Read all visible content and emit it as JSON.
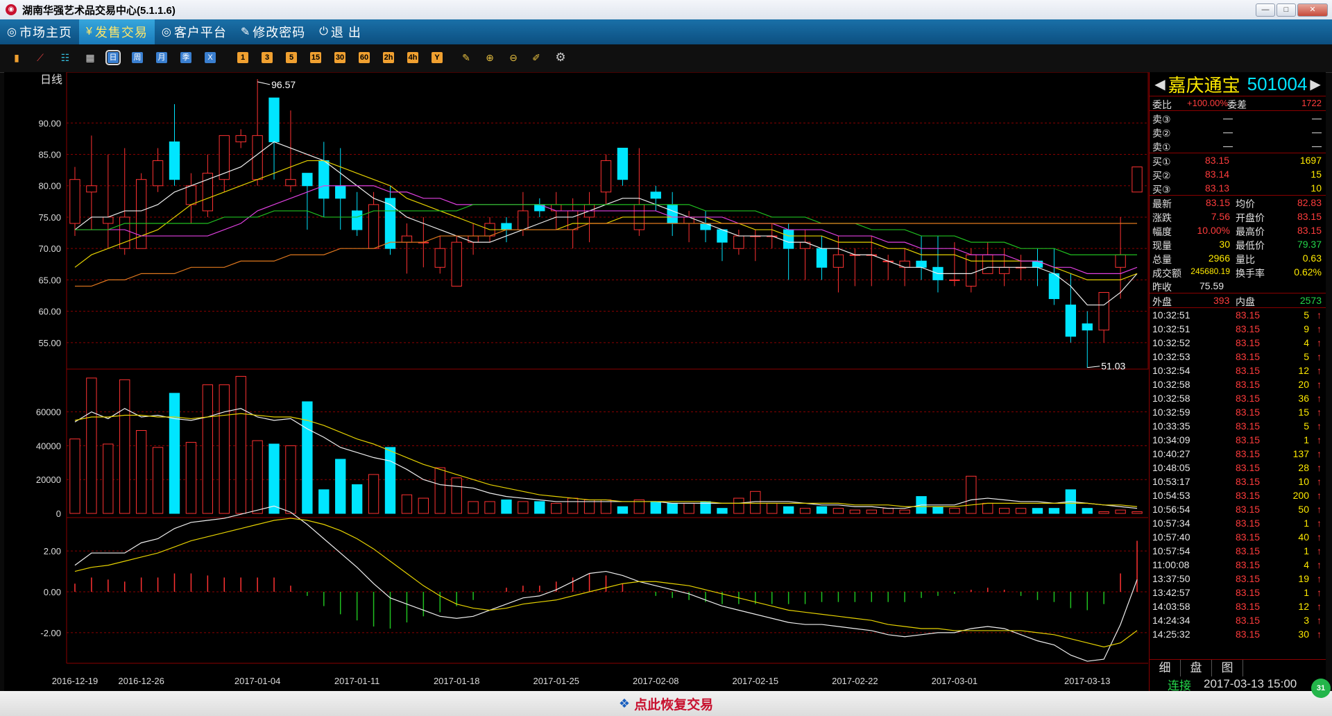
{
  "window": {
    "title": "湖南华强艺术品交易中心(5.1.1.6)",
    "min_label": "—",
    "max_label": "□",
    "close_label": "✕"
  },
  "menu": {
    "items": [
      {
        "icon": "◎",
        "label": "市场主页",
        "active": false
      },
      {
        "icon": "¥",
        "label": "发售交易",
        "active": true
      },
      {
        "icon": "◎",
        "label": "客户平台",
        "active": false
      },
      {
        "icon": "✎",
        "label": "修改密码",
        "active": false
      },
      {
        "icon": "⏻",
        "label": "退  出",
        "active": false
      }
    ]
  },
  "toolbar": {
    "chart_icons": [
      "bar-chart-icon",
      "line-chart-icon",
      "candlestick-icon",
      "calendar-icon"
    ],
    "period_buttons": [
      "日",
      "周",
      "月",
      "季",
      "X"
    ],
    "minute_buttons": [
      "1",
      "3",
      "5",
      "15",
      "30",
      "60",
      "2h",
      "4h",
      "Y"
    ],
    "settings_icon": "gear-icon"
  },
  "quote": {
    "name": "嘉庆通宝",
    "code": "501004",
    "weibi_label": "委比",
    "weibi": "+100.00%",
    "weicha_label": "委差",
    "weicha": "1722",
    "sell": [
      {
        "label": "卖③",
        "price": "—",
        "vol": "—"
      },
      {
        "label": "卖②",
        "price": "—",
        "vol": "—"
      },
      {
        "label": "卖①",
        "price": "—",
        "vol": "—"
      }
    ],
    "buy": [
      {
        "label": "买①",
        "price": "83.15",
        "vol": "1697"
      },
      {
        "label": "买②",
        "price": "83.14",
        "vol": "15"
      },
      {
        "label": "买③",
        "price": "83.13",
        "vol": "10"
      }
    ],
    "stats": [
      {
        "l1": "最新",
        "v1": "83.15",
        "l2": "均价",
        "v2": "82.83"
      },
      {
        "l1": "涨跌",
        "v1": "7.56",
        "l2": "开盘价",
        "v2": "83.15"
      },
      {
        "l1": "幅度",
        "v1": "10.00%",
        "l2": "最高价",
        "v2": "83.15"
      },
      {
        "l1": "现量",
        "v1": "30",
        "l2": "最低价",
        "v2": "79.37"
      },
      {
        "l1": "总量",
        "v1": "2966",
        "l2": "量比",
        "v2": "0.63"
      },
      {
        "l1": "成交额",
        "v1": "245680.19",
        "l2": "换手率",
        "v2": "0.62%"
      }
    ],
    "zuoshou_label": "昨收",
    "zuoshou": "75.59",
    "waipan_label": "外盘",
    "waipan": "393",
    "neipan_label": "内盘",
    "neipan": "2573",
    "ticks": [
      {
        "t": "10:32:51",
        "p": "83.15",
        "v": "5"
      },
      {
        "t": "10:32:51",
        "p": "83.15",
        "v": "9"
      },
      {
        "t": "10:32:52",
        "p": "83.15",
        "v": "4"
      },
      {
        "t": "10:32:53",
        "p": "83.15",
        "v": "5"
      },
      {
        "t": "10:32:54",
        "p": "83.15",
        "v": "12"
      },
      {
        "t": "10:32:58",
        "p": "83.15",
        "v": "20"
      },
      {
        "t": "10:32:58",
        "p": "83.15",
        "v": "36"
      },
      {
        "t": "10:32:59",
        "p": "83.15",
        "v": "15"
      },
      {
        "t": "10:33:35",
        "p": "83.15",
        "v": "5"
      },
      {
        "t": "10:34:09",
        "p": "83.15",
        "v": "1"
      },
      {
        "t": "10:40:27",
        "p": "83.15",
        "v": "137"
      },
      {
        "t": "10:48:05",
        "p": "83.15",
        "v": "28"
      },
      {
        "t": "10:53:17",
        "p": "83.15",
        "v": "10"
      },
      {
        "t": "10:54:53",
        "p": "83.15",
        "v": "200"
      },
      {
        "t": "10:56:54",
        "p": "83.15",
        "v": "50"
      },
      {
        "t": "10:57:34",
        "p": "83.15",
        "v": "1"
      },
      {
        "t": "10:57:40",
        "p": "83.15",
        "v": "40"
      },
      {
        "t": "10:57:54",
        "p": "83.15",
        "v": "1"
      },
      {
        "t": "11:00:08",
        "p": "83.15",
        "v": "4"
      },
      {
        "t": "13:37:50",
        "p": "83.15",
        "v": "19"
      },
      {
        "t": "13:42:57",
        "p": "83.15",
        "v": "1"
      },
      {
        "t": "14:03:58",
        "p": "83.15",
        "v": "12"
      },
      {
        "t": "14:24:34",
        "p": "83.15",
        "v": "3"
      },
      {
        "t": "14:25:32",
        "p": "83.15",
        "v": "30"
      }
    ],
    "tabs": [
      "细",
      "盘",
      "图"
    ],
    "status": "连接",
    "datetime": "2017-03-13 15:00"
  },
  "bottom": {
    "restore_label": "点此恢复交易",
    "badge": "31"
  },
  "chart_data": {
    "type": "candlestick",
    "period_label": "日线",
    "price_ticks": [
      90,
      85,
      80,
      75,
      70,
      65,
      60,
      55
    ],
    "price_tick_labels": [
      "90.00",
      "85.00",
      "80.00",
      "75.00",
      "70.00",
      "65.00",
      "60.00",
      "55.00"
    ],
    "price_range": [
      51,
      97
    ],
    "high_label": "96.57",
    "low_label": "51.03",
    "vol_ticks": [
      60000,
      40000,
      20000,
      0
    ],
    "vol_tick_labels": [
      "60000",
      "40000",
      "20000",
      "0"
    ],
    "vol_range": [
      0,
      82000
    ],
    "macd_ticks": [
      2,
      0,
      -2
    ],
    "macd_tick_labels": [
      "2.00",
      "0.00",
      "-2.00"
    ],
    "macd_range": [
      -3.5,
      3.5
    ],
    "date_labels": [
      {
        "i": 0,
        "t": "2016-12-19"
      },
      {
        "i": 4,
        "t": "2016-12-26"
      },
      {
        "i": 11,
        "t": "2017-01-04"
      },
      {
        "i": 17,
        "t": "2017-01-11"
      },
      {
        "i": 23,
        "t": "2017-01-18"
      },
      {
        "i": 29,
        "t": "2017-01-25"
      },
      {
        "i": 35,
        "t": "2017-02-08"
      },
      {
        "i": 41,
        "t": "2017-02-15"
      },
      {
        "i": 47,
        "t": "2017-02-22"
      },
      {
        "i": 53,
        "t": "2017-03-01"
      },
      {
        "i": 61,
        "t": "2017-03-13"
      }
    ],
    "candles": [
      [
        74,
        81,
        72,
        83
      ],
      [
        79,
        80,
        73,
        88
      ],
      [
        74,
        75,
        70,
        85
      ],
      [
        70,
        75,
        69,
        86
      ],
      [
        70,
        81,
        70,
        82
      ],
      [
        80,
        84,
        79,
        86
      ],
      [
        87,
        81,
        80,
        93
      ],
      [
        77,
        80,
        74,
        82
      ],
      [
        76,
        82,
        75,
        85
      ],
      [
        81,
        88,
        79,
        88
      ],
      [
        87,
        88,
        86,
        89
      ],
      [
        81,
        88,
        80,
        97
      ],
      [
        94,
        87,
        81,
        94
      ],
      [
        80,
        81,
        79,
        92
      ],
      [
        82,
        80,
        73,
        82
      ],
      [
        84,
        78,
        75,
        87
      ],
      [
        80,
        78,
        73,
        86
      ],
      [
        76,
        73,
        72,
        79
      ],
      [
        70,
        77,
        70,
        79
      ],
      [
        78,
        70,
        69,
        80
      ],
      [
        71,
        72,
        66,
        74
      ],
      [
        71,
        71,
        67,
        75
      ],
      [
        67,
        70,
        66,
        72
      ],
      [
        64,
        71,
        64,
        72
      ],
      [
        71,
        72,
        69,
        74
      ],
      [
        72,
        74,
        71,
        75
      ],
      [
        74,
        73,
        71,
        75
      ],
      [
        73,
        76,
        72,
        79
      ],
      [
        77,
        76,
        75,
        78
      ],
      [
        76,
        77,
        73,
        79
      ],
      [
        73,
        76,
        70,
        78
      ],
      [
        75,
        77,
        71,
        79
      ],
      [
        79,
        84,
        77,
        85
      ],
      [
        86,
        81,
        80,
        86
      ],
      [
        73,
        77,
        72,
        86
      ],
      [
        79,
        78,
        76,
        80
      ],
      [
        77,
        74,
        72,
        79
      ],
      [
        74,
        75,
        71,
        76
      ],
      [
        74,
        73,
        71,
        76
      ],
      [
        73,
        71,
        68,
        73
      ],
      [
        70,
        72,
        69,
        73
      ],
      [
        72,
        72,
        68,
        73
      ],
      [
        72,
        72,
        70,
        74
      ],
      [
        73,
        70,
        65,
        74
      ],
      [
        70,
        71,
        65,
        73
      ],
      [
        70,
        67,
        65,
        72
      ],
      [
        67,
        69,
        63,
        72
      ],
      [
        69,
        69,
        64,
        70
      ],
      [
        69,
        69,
        64,
        72
      ],
      [
        68,
        68,
        65,
        69
      ],
      [
        67,
        68,
        64,
        70
      ],
      [
        68,
        67,
        65,
        72
      ],
      [
        67,
        65,
        63,
        72
      ],
      [
        65,
        65,
        64,
        71
      ],
      [
        64,
        69,
        63,
        70
      ],
      [
        66,
        69,
        66,
        71
      ],
      [
        66,
        67,
        64,
        70
      ],
      [
        67,
        67,
        65,
        69
      ],
      [
        68,
        67,
        64,
        70
      ],
      [
        66,
        62,
        61,
        70
      ],
      [
        61,
        56,
        55,
        66
      ],
      [
        58,
        57,
        51,
        60
      ],
      [
        57,
        63,
        55,
        63
      ],
      [
        67,
        69,
        62,
        75
      ],
      [
        79,
        83,
        79,
        83
      ]
    ],
    "volumes": [
      44000,
      80000,
      41000,
      79000,
      49000,
      39000,
      71000,
      42000,
      76000,
      76000,
      81000,
      43000,
      41000,
      40000,
      66000,
      14000,
      32000,
      17000,
      23000,
      39000,
      11000,
      9000,
      27000,
      21000,
      7000,
      7000,
      8000,
      7000,
      7000,
      6000,
      9000,
      8000,
      8000,
      4000,
      8000,
      7000,
      6000,
      6000,
      7000,
      3000,
      9000,
      13000,
      6000,
      4000,
      3000,
      4000,
      3000,
      2000,
      2000,
      3000,
      2000,
      10000,
      4000,
      3000,
      22000,
      6000,
      3000,
      3000,
      3000,
      3000,
      14000,
      3000,
      1000,
      2000,
      1000
    ],
    "ma_volumes": {
      "white": [
        54000,
        60000,
        56000,
        62000,
        57000,
        58000,
        56000,
        55000,
        57000,
        60000,
        62000,
        57000,
        55000,
        56000,
        50000,
        45000,
        39000,
        36000,
        33000,
        31000,
        26000,
        20000,
        17000,
        16000,
        15000,
        12000,
        10000,
        9000,
        8000,
        7000,
        7000,
        7000,
        7000,
        7000,
        7000,
        7000,
        6000,
        6000,
        6000,
        6000,
        6000,
        7000,
        7000,
        7000,
        6000,
        5000,
        5000,
        4000,
        4000,
        3000,
        3000,
        5000,
        5000,
        5000,
        8000,
        9000,
        8000,
        7000,
        7000,
        6000,
        7000,
        6000,
        5000,
        4000,
        3000
      ],
      "yellow": [
        55000,
        57000,
        57000,
        58000,
        58000,
        57000,
        57000,
        56000,
        57000,
        58000,
        59000,
        58000,
        57000,
        57000,
        55000,
        52000,
        48000,
        44000,
        41000,
        37000,
        33000,
        29000,
        26000,
        23000,
        20000,
        17000,
        15000,
        13000,
        11000,
        10000,
        9000,
        8000,
        8000,
        7000,
        7000,
        7000,
        7000,
        7000,
        7000,
        6000,
        6000,
        6000,
        6000,
        6000,
        6000,
        6000,
        6000,
        5000,
        5000,
        5000,
        4000,
        4000,
        4000,
        4000,
        5000,
        6000,
        6000,
        6000,
        6000,
        6000,
        6000,
        6000,
        5000,
        5000,
        4000
      ]
    },
    "mas": {
      "white": [
        73,
        75,
        75,
        76,
        76,
        77,
        79,
        80,
        81,
        82,
        83,
        85,
        87,
        86,
        85,
        84,
        82,
        80,
        78,
        77,
        75,
        74,
        73,
        72,
        71,
        71,
        72,
        73,
        74,
        75,
        75,
        76,
        77,
        78,
        78,
        77,
        76,
        75,
        74,
        73,
        72,
        72,
        72,
        71,
        71,
        70,
        70,
        69,
        69,
        68,
        67,
        67,
        66,
        66,
        66,
        67,
        67,
        67,
        67,
        66,
        64,
        61,
        61,
        63,
        66
      ],
      "yellow": [
        67,
        69,
        70,
        71,
        72,
        73,
        75,
        77,
        78,
        79,
        80,
        81,
        82,
        83,
        84,
        84,
        83,
        82,
        81,
        80,
        78,
        77,
        76,
        75,
        74,
        73,
        73,
        73,
        73,
        73,
        74,
        74,
        74,
        75,
        75,
        75,
        75,
        75,
        75,
        74,
        74,
        73,
        73,
        72,
        72,
        72,
        71,
        71,
        71,
        70,
        70,
        69,
        69,
        69,
        68,
        68,
        68,
        68,
        68,
        67,
        66,
        65,
        65,
        65,
        66
      ],
      "magenta": [
        73,
        73,
        73,
        73,
        72,
        72,
        72,
        72,
        72,
        73,
        74,
        76,
        77,
        78,
        79,
        80,
        80,
        80,
        80,
        79,
        79,
        78,
        78,
        77,
        77,
        77,
        77,
        77,
        77,
        76,
        76,
        76,
        76,
        76,
        76,
        76,
        75,
        75,
        75,
        75,
        74,
        74,
        74,
        73,
        73,
        73,
        72,
        72,
        72,
        71,
        71,
        70,
        70,
        70,
        69,
        69,
        69,
        68,
        68,
        67,
        67,
        66,
        66,
        66,
        67
      ],
      "green": [
        73,
        73,
        73,
        74,
        74,
        74,
        74,
        74,
        74,
        75,
        75,
        75,
        76,
        76,
        76,
        75,
        75,
        75,
        76,
        76,
        76,
        76,
        76,
        76,
        77,
        77,
        77,
        77,
        77,
        77,
        77,
        77,
        77,
        77,
        77,
        77,
        77,
        77,
        76,
        76,
        76,
        76,
        75,
        75,
        75,
        74,
        74,
        74,
        73,
        73,
        73,
        72,
        72,
        72,
        71,
        71,
        71,
        70,
        70,
        70,
        69,
        69,
        69,
        69,
        69
      ],
      "orange": [
        64,
        64,
        65,
        65,
        66,
        66,
        66,
        67,
        67,
        67,
        68,
        68,
        68,
        69,
        69,
        69,
        70,
        70,
        70,
        71,
        71,
        71,
        72,
        72,
        72,
        72,
        73,
        73,
        73,
        73,
        73,
        74,
        74,
        74,
        74,
        74,
        74,
        74,
        74,
        74,
        74,
        74,
        74,
        74,
        74,
        74,
        74,
        74,
        74,
        74,
        74,
        74,
        74,
        74,
        74,
        74,
        74,
        74,
        74,
        74,
        74,
        74,
        74,
        74,
        74
      ]
    },
    "macd": {
      "dif": [
        1.3,
        1.9,
        1.9,
        1.9,
        2.4,
        2.6,
        3.1,
        3.4,
        3.5,
        3.6,
        3.8,
        4.0,
        4.2,
        3.9,
        3.3,
        2.6,
        1.9,
        1.2,
        0.4,
        -0.3,
        -0.6,
        -0.9,
        -1.2,
        -1.3,
        -1.2,
        -0.9,
        -0.6,
        -0.3,
        -0.2,
        0.1,
        0.5,
        0.9,
        1.0,
        0.8,
        0.5,
        0.3,
        0.1,
        -0.1,
        -0.4,
        -0.7,
        -0.9,
        -1.1,
        -1.3,
        -1.5,
        -1.6,
        -1.6,
        -1.7,
        -1.8,
        -1.9,
        -2.1,
        -2.2,
        -2.1,
        -2.0,
        -2.0,
        -1.8,
        -1.7,
        -1.8,
        -2.1,
        -2.4,
        -2.6,
        -3.1,
        -3.4,
        -3.3,
        -1.6,
        0.6
      ],
      "dea": [
        1.0,
        1.2,
        1.3,
        1.5,
        1.7,
        1.9,
        2.2,
        2.5,
        2.7,
        2.9,
        3.1,
        3.3,
        3.5,
        3.6,
        3.5,
        3.3,
        3.0,
        2.6,
        2.1,
        1.5,
        0.9,
        0.3,
        -0.2,
        -0.6,
        -0.8,
        -0.9,
        -0.8,
        -0.6,
        -0.5,
        -0.4,
        -0.2,
        0.0,
        0.2,
        0.4,
        0.5,
        0.5,
        0.4,
        0.3,
        0.1,
        -0.1,
        -0.3,
        -0.5,
        -0.7,
        -0.9,
        -1.0,
        -1.1,
        -1.2,
        -1.3,
        -1.4,
        -1.6,
        -1.7,
        -1.8,
        -1.8,
        -1.9,
        -1.9,
        -1.9,
        -1.9,
        -1.9,
        -2.0,
        -2.1,
        -2.3,
        -2.5,
        -2.7,
        -2.5,
        -1.9
      ],
      "bars": [
        0.4,
        0.7,
        0.6,
        0.5,
        0.7,
        0.7,
        0.9,
        0.9,
        0.8,
        0.7,
        0.7,
        0.7,
        0.7,
        0.3,
        -0.2,
        -0.7,
        -1.1,
        -1.4,
        -1.7,
        -1.8,
        -1.5,
        -1.2,
        -1.0,
        -0.7,
        -0.4,
        0.0,
        0.2,
        0.3,
        0.3,
        0.5,
        0.7,
        0.9,
        0.8,
        0.4,
        0.0,
        -0.2,
        -0.3,
        -0.4,
        -0.5,
        -0.6,
        -0.6,
        -0.6,
        -0.6,
        -0.6,
        -0.6,
        -0.5,
        -0.5,
        -0.5,
        -0.5,
        -0.5,
        -0.5,
        -0.3,
        -0.2,
        -0.1,
        0.1,
        0.2,
        0.1,
        -0.2,
        -0.4,
        -0.5,
        -0.8,
        -0.9,
        -0.6,
        0.9,
        2.5
      ]
    }
  }
}
